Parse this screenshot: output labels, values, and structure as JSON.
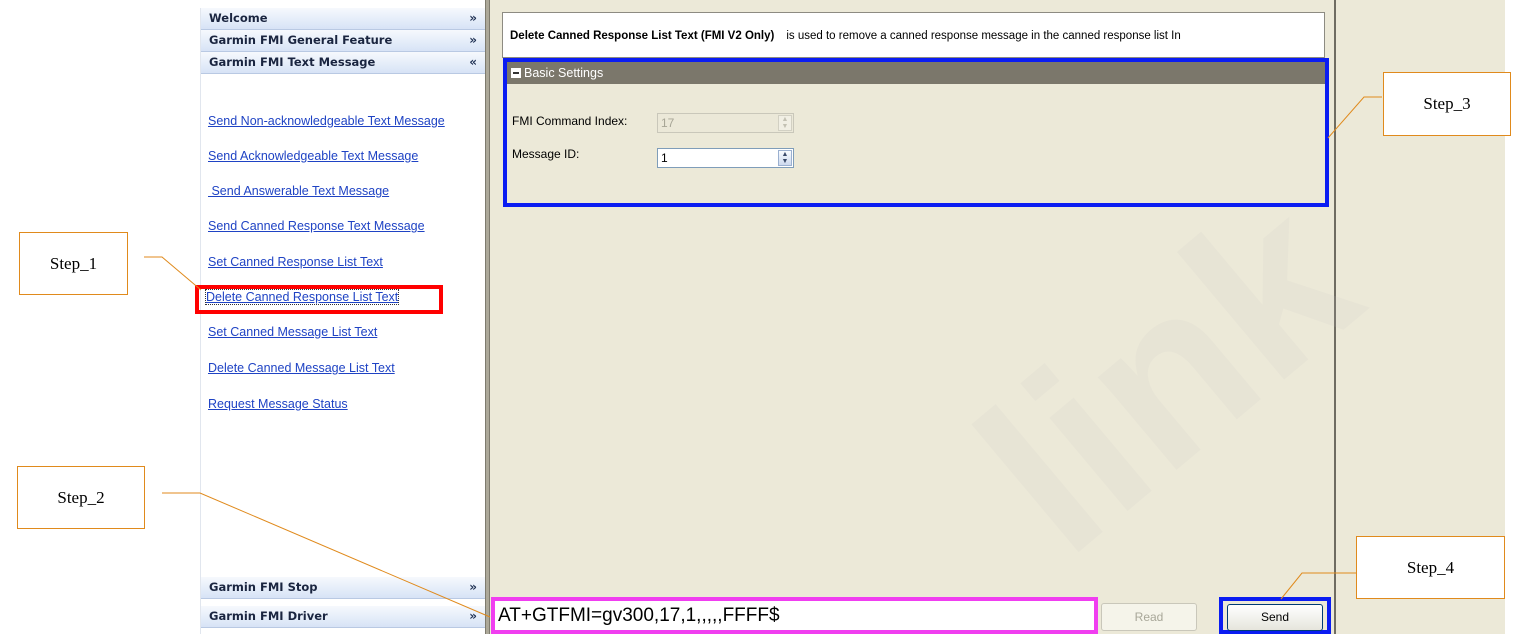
{
  "sidebar": {
    "headers_top": [
      {
        "label": "Welcome",
        "chevron": "»",
        "state": "collapsed"
      },
      {
        "label": "Garmin FMI General Feature",
        "chevron": "»",
        "state": "collapsed"
      },
      {
        "label": "Garmin FMI Text Message",
        "chevron": "«",
        "state": "expanded"
      }
    ],
    "links": [
      "Send Non-acknowledgeable Text Message",
      "Send Acknowledgeable Text Message",
      " Send Answerable Text Message",
      "Send Canned Response Text Message",
      "Set Canned Response List Text",
      "Delete Canned Response List Text",
      "Set Canned Message List Text",
      "Delete Canned Message List Text",
      "Request Message Status"
    ],
    "headers_bottom": [
      {
        "label": "Garmin FMI Stop",
        "chevron": "»",
        "state": "collapsed"
      },
      {
        "label": "Garmin FMI Driver",
        "chevron": "»",
        "state": "collapsed"
      }
    ]
  },
  "main": {
    "description": {
      "title": "Delete Canned Response List Text (FMI V2 Only)",
      "text": "is used to remove a canned response message in the canned response list In"
    },
    "basic_settings": {
      "title": "Basic Settings",
      "fields": [
        {
          "label": "FMI Command Index:",
          "value": "17",
          "disabled": true
        },
        {
          "label": "Message ID:",
          "value": "1",
          "disabled": false
        }
      ]
    },
    "command": "AT+GTFMI=gv300,17,1,,,,,FFFF$",
    "read_label": "Read",
    "send_label": "Send"
  },
  "callouts": {
    "step1": "Step_1",
    "step2": "Step_2",
    "step3": "Step_3",
    "step4": "Step_4"
  },
  "colors": {
    "highlight_red": "#ff0000",
    "highlight_blue": "#0a1cf2",
    "highlight_magenta": "#f03ef0",
    "callout_orange": "#e08a1c",
    "link_blue": "#1f43c4",
    "panel_beige": "#ece9d8"
  },
  "icons": {
    "collapse": "chevron-double-down-icon",
    "expand": "chevron-double-up-icon",
    "section_toggle": "minus-box-icon",
    "spinner": "spin-arrows-icon"
  }
}
